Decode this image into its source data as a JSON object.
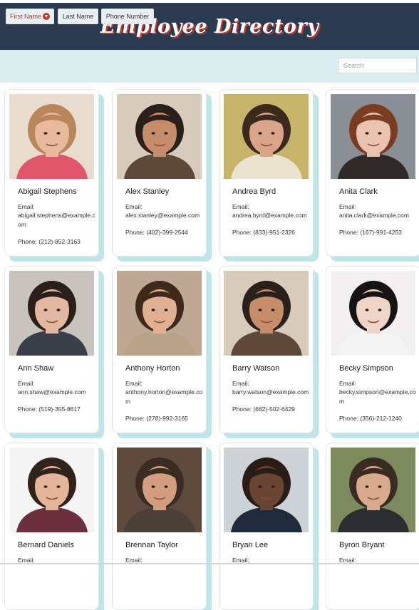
{
  "header": {
    "title": "Employee Directory"
  },
  "sort": {
    "buttons": [
      {
        "label": "First Name",
        "active": true
      },
      {
        "label": "Last Name",
        "active": false
      },
      {
        "label": "Phone Number",
        "active": false
      }
    ],
    "sort_icon": "chevron-down-icon"
  },
  "search": {
    "placeholder": "Search",
    "value": ""
  },
  "labels": {
    "email": "Email:",
    "phone_prefix": "Phone: "
  },
  "employees": [
    {
      "name": "Abigail Stephens",
      "email": "abigail.stephens@example.com",
      "phone": "(212)-852-3163",
      "photo": "woman-blonde-pink-shirt"
    },
    {
      "name": "Alex Stanley",
      "email": "alex.stanley@example.com",
      "phone": "(402)-399-2544",
      "photo": "man-dark-hair-hand-gesture"
    },
    {
      "name": "Andrea Byrd",
      "email": "andrea.byrd@example.com",
      "phone": "(833)-951-2326",
      "photo": "woman-long-dark-hair"
    },
    {
      "name": "Anita Clark",
      "email": "anita.clark@example.com",
      "phone": "(167)-991-4253",
      "photo": "woman-red-hair-selfie"
    },
    {
      "name": "Ann Shaw",
      "email": "ann.shaw@example.com",
      "phone": "(519)-355-8617",
      "photo": "woman-long-dark-hair-looking-down"
    },
    {
      "name": "Anthony Horton",
      "email": "anthony.horton@example.com",
      "phone": "(278)-992-3165",
      "photo": "man-short-hair-jacket"
    },
    {
      "name": "Barry Watson",
      "email": "barry.watson@example.com",
      "phone": "(682)-502-6429",
      "photo": "man-dark-hair-hand-gesture"
    },
    {
      "name": "Becky Simpson",
      "email": "becky.simpson@example.com",
      "phone": "(356)-212-1240",
      "photo": "person-white-background-hand-on-head"
    },
    {
      "name": "Bernard Daniels",
      "email": "",
      "phone": "",
      "photo": "man-beard-maroon-shirt"
    },
    {
      "name": "Brennan Taylor",
      "email": "",
      "phone": "",
      "photo": "man-stubble-dark-shirt"
    },
    {
      "name": "Bryan Lee",
      "email": "",
      "phone": "",
      "photo": "man-bald-suit"
    },
    {
      "name": "Byron Bryant",
      "email": "",
      "phone": "",
      "photo": "man-puffer-jacket-outdoors"
    }
  ],
  "colors": {
    "header_bg": "#2c3a4f",
    "sortbar_bg": "#dbeeef",
    "accent": "#c0392b",
    "card_shadow": "#bfe4ea"
  }
}
